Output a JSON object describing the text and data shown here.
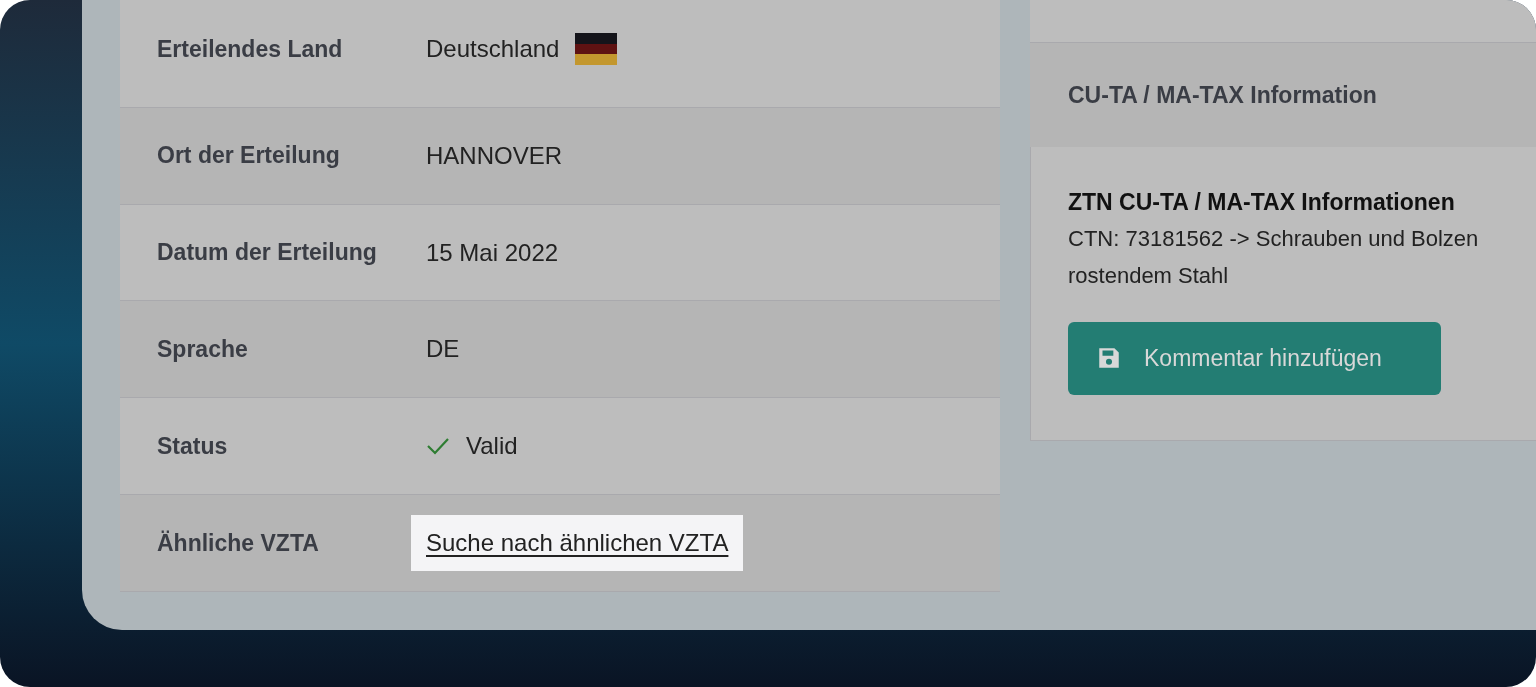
{
  "details": [
    {
      "kind": "flag",
      "label": "Erteilendes Land",
      "value": "Deutschland"
    },
    {
      "kind": "text",
      "label": "Ort der Erteilung",
      "value": "HANNOVER"
    },
    {
      "kind": "text",
      "label": "Datum der Erteilung",
      "value": "15 Mai 2022"
    },
    {
      "kind": "text",
      "label": "Sprache",
      "value": "DE"
    },
    {
      "kind": "status",
      "label": "Status",
      "value": "Valid"
    },
    {
      "kind": "link",
      "label": "Ähnliche VZTA",
      "value": "Suche nach ähnlichen VZTA",
      "highlighted": true
    }
  ],
  "info_card": {
    "header": "CU-TA / MA-TAX Information",
    "title": "ZTN CU-TA / MA-TAX Informationen",
    "lines": [
      "CTN: 73181562 -> Schrauben und Bolzen",
      "rostendem Stahl"
    ],
    "button": "Kommentar hinzufügen"
  }
}
